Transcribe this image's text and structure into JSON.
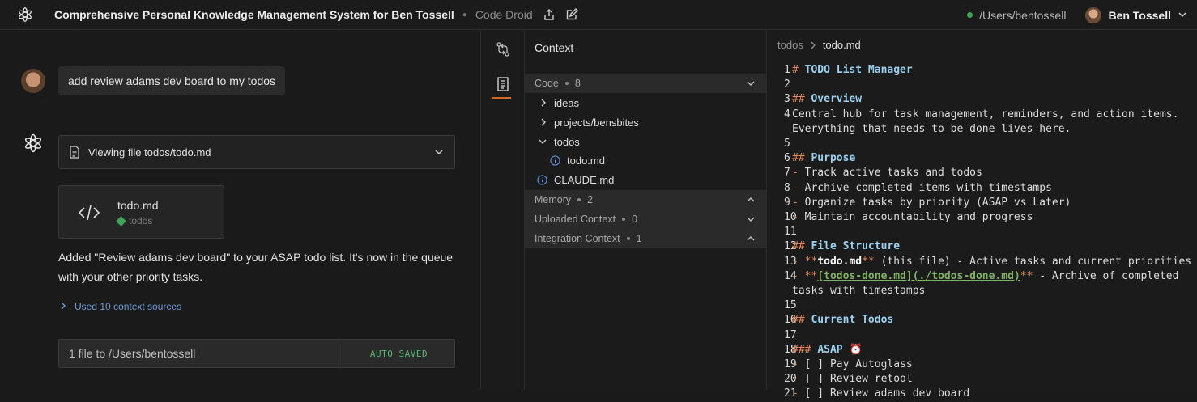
{
  "app": {
    "title": "Comprehensive Personal Knowledge Management System for Ben Tossell",
    "subtitle": "Code Droid",
    "path": "/Users/bentossell",
    "user_name": "Ben Tossell"
  },
  "chat": {
    "user_message": "add review adams dev board to my todos",
    "viewing_label": "Viewing file todos/todo.md",
    "file_card": {
      "name": "todo.md",
      "dir": "todos"
    },
    "answer": "Added \"Review adams dev board\" to your ASAP todo list. It's now in the queue with your other priority tasks.",
    "context_sources": "Used 10 context sources",
    "save_left": "1 file to /Users/bentossell",
    "save_right": "AUTO SAVED"
  },
  "context": {
    "header": "Context",
    "sections": {
      "code": {
        "label": "Code",
        "count": "8"
      },
      "memory": {
        "label": "Memory",
        "count": "2"
      },
      "uploaded": {
        "label": "Uploaded Context",
        "count": "0"
      },
      "integration": {
        "label": "Integration Context",
        "count": "1"
      }
    },
    "tree": {
      "ideas": "ideas",
      "projects": "projects/bensbites",
      "todos": "todos",
      "todo_md": "todo.md",
      "claude_md": "CLAUDE.md"
    }
  },
  "editor": {
    "crumb_folder": "todos",
    "crumb_file": "todo.md",
    "lines": [
      {
        "n": "1",
        "parts": [
          [
            "hl",
            "# "
          ],
          [
            "hd",
            "TODO List Manager"
          ]
        ]
      },
      {
        "n": "2",
        "parts": []
      },
      {
        "n": "3",
        "parts": [
          [
            "hl",
            "## "
          ],
          [
            "hd",
            "Overview"
          ]
        ]
      },
      {
        "n": "4",
        "parts": [
          [
            "",
            "Central hub for task management, reminders, and action items. Everything that needs to be done lives here."
          ]
        ]
      },
      {
        "n": "5",
        "parts": []
      },
      {
        "n": "6",
        "parts": [
          [
            "hl",
            "## "
          ],
          [
            "hd",
            "Purpose"
          ]
        ]
      },
      {
        "n": "7",
        "parts": [
          [
            "hl",
            "- "
          ],
          [
            "",
            "Track active tasks and todos"
          ]
        ]
      },
      {
        "n": "8",
        "parts": [
          [
            "hl",
            "- "
          ],
          [
            "",
            "Archive completed items with timestamps"
          ]
        ]
      },
      {
        "n": "9",
        "parts": [
          [
            "hl",
            "- "
          ],
          [
            "",
            "Organize tasks by priority (ASAP vs Later)"
          ]
        ]
      },
      {
        "n": "10",
        "parts": [
          [
            "hl",
            "- "
          ],
          [
            "",
            "Maintain accountability and progress"
          ]
        ]
      },
      {
        "n": "11",
        "parts": []
      },
      {
        "n": "12",
        "parts": [
          [
            "hl",
            "## "
          ],
          [
            "hd",
            "File Structure"
          ]
        ]
      },
      {
        "n": "13",
        "parts": [
          [
            "hl",
            "- **"
          ],
          [
            "bd",
            "todo.md"
          ],
          [
            "hl",
            "**"
          ],
          [
            "",
            " (this file) - Active tasks and current priorities"
          ]
        ]
      },
      {
        "n": "14",
        "parts": [
          [
            "hl",
            "- **"
          ],
          [
            "lnk",
            "[todos-done.md](./todos-done.md)"
          ],
          [
            "hl",
            "**"
          ],
          [
            "",
            " - Archive of completed tasks with timestamps"
          ]
        ]
      },
      {
        "n": "15",
        "parts": []
      },
      {
        "n": "16",
        "parts": [
          [
            "hl",
            "## "
          ],
          [
            "hd",
            "Current Todos"
          ]
        ]
      },
      {
        "n": "17",
        "parts": []
      },
      {
        "n": "18",
        "parts": [
          [
            "hl",
            "### "
          ],
          [
            "hd",
            "ASAP ⏰"
          ]
        ]
      },
      {
        "n": "19",
        "parts": [
          [
            "hl",
            "- "
          ],
          [
            "",
            "[ ] Pay Autoglass"
          ]
        ]
      },
      {
        "n": "20",
        "parts": [
          [
            "hl",
            "- "
          ],
          [
            "",
            "[ ] Review retool"
          ]
        ]
      },
      {
        "n": "21",
        "parts": [
          [
            "hl",
            "- "
          ],
          [
            "",
            "[ ] Review adams dev board"
          ]
        ]
      }
    ]
  },
  "icons": {
    "logo": "droid-asterisk-icon",
    "share": "share-icon",
    "edit": "edit-icon",
    "diff": "git-compare-icon",
    "doc": "document-icon"
  },
  "colors": {
    "accent": "#d46a1f",
    "status_green": "#3fa35a",
    "link_blue": "#6f9cd6",
    "saved_green": "#58b475"
  }
}
